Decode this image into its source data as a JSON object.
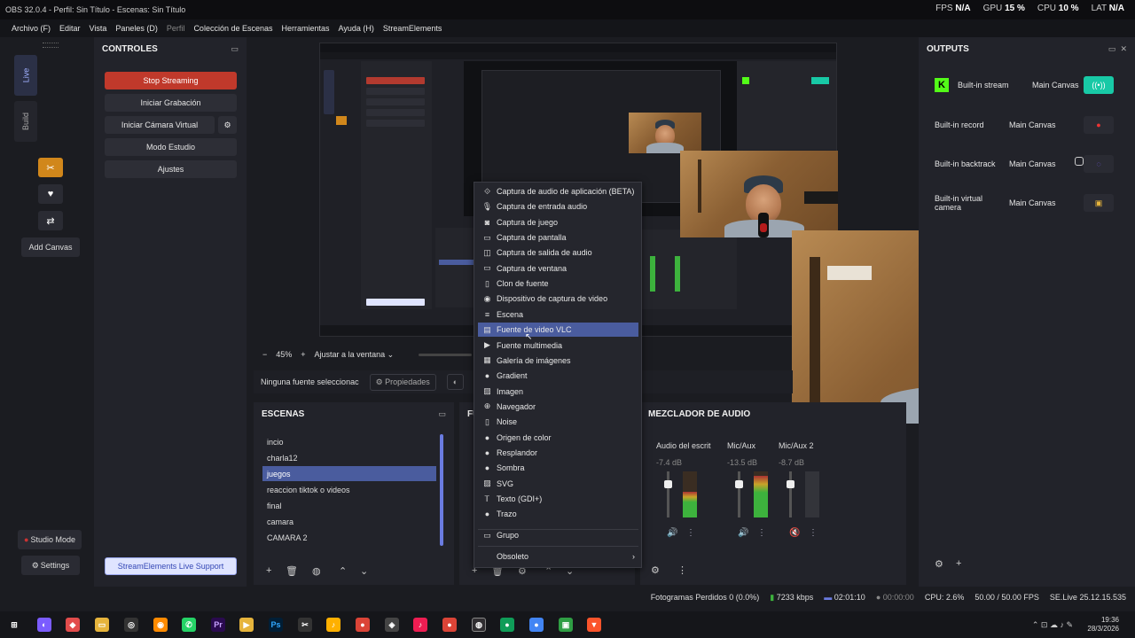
{
  "window": {
    "title": "OBS 32.0.4 - Perfil: Sin Título - Escenas: Sin Título",
    "stats": {
      "fps_label": "FPS",
      "fps_value": "N/A",
      "gpu_label": "GPU",
      "gpu_value": "15 %",
      "cpu_label": "CPU",
      "cpu_value": "10 %",
      "lat_label": "LAT",
      "lat_value": "N/A"
    }
  },
  "menubar": {
    "archivo": "Archivo (F)",
    "editar": "Editar",
    "vista": "Vista",
    "paneles": "Paneles (D)",
    "perfil": "Perfil",
    "coleccion": "Colección de Escenas",
    "herramientas": "Herramientas",
    "ayuda": "Ayuda (H)",
    "streamelements": "StreamElements"
  },
  "rail": {
    "tab_live": "Live",
    "tab_build": "Build",
    "add_canvas": "Add Canvas",
    "studio_mode": "Studio Mode",
    "settings": "Settings",
    "icons": [
      "scissors-icon",
      "heart-icon",
      "share-icon"
    ]
  },
  "controls": {
    "title": "CONTROLES",
    "stop_streaming": "Stop Streaming",
    "start_recording": "Iniciar Grabación",
    "start_virtualcam": "Iniciar Cámara Virtual",
    "studio_mode": "Modo Estudio",
    "settings": "Ajustes",
    "se_support": "StreamElements Live Support"
  },
  "preview": {
    "zoom": "45%",
    "fit": "Ajustar a la ventana",
    "no_source": "Ninguna fuente seleccionac",
    "properties": "Propiedades"
  },
  "scenes": {
    "title": "ESCENAS",
    "items": [
      "incio",
      "charla12",
      "juegos",
      "reaccion tiktok o videos",
      "final",
      "camara",
      "CAMARA 2"
    ],
    "selected_index": 2
  },
  "sources": {
    "title_partial": "FU"
  },
  "mixer": {
    "title": "MEZCLADOR DE AUDIO",
    "channels": [
      {
        "name": "Audio del escrit",
        "db": "-7.4 dB",
        "level": 0.55,
        "muted": false
      },
      {
        "name": "Mic/Aux",
        "db": "-13.5 dB",
        "level": 0.9,
        "muted": false
      },
      {
        "name": "Mic/Aux 2",
        "db": "-8.7 dB",
        "level": 0.0,
        "muted": true
      }
    ]
  },
  "outputs": {
    "title": "OUTPUTS",
    "rows": [
      {
        "name": "Built-in stream",
        "canvas": "Main Canvas",
        "active": true
      },
      {
        "name": "Built-in record",
        "canvas": "Main Canvas",
        "active": false
      },
      {
        "name": "Built-in backtrack",
        "canvas": "Main Canvas",
        "active": false
      },
      {
        "name": "Built-in virtual camera",
        "canvas": "Main Canvas",
        "active": false
      }
    ]
  },
  "context_menu": {
    "items": [
      {
        "label": "Captura de audio de aplicación (BETA)",
        "icon": "app-audio-icon"
      },
      {
        "label": "Captura de entrada audio",
        "icon": "microphone-icon"
      },
      {
        "label": "Captura de juego",
        "icon": "gamepad-icon"
      },
      {
        "label": "Captura de pantalla",
        "icon": "monitor-icon"
      },
      {
        "label": "Captura de salida de audio",
        "icon": "speaker-icon"
      },
      {
        "label": "Captura de ventana",
        "icon": "window-icon"
      },
      {
        "label": "Clon de fuente",
        "icon": "clone-icon"
      },
      {
        "label": "Dispositivo de captura de video",
        "icon": "camera-icon"
      },
      {
        "label": "Escena",
        "icon": "scene-icon"
      },
      {
        "label": "Fuente de video VLC",
        "icon": "film-icon"
      },
      {
        "label": "Fuente multimedia",
        "icon": "media-icon"
      },
      {
        "label": "Galería de imágenes",
        "icon": "gallery-icon"
      },
      {
        "label": "Gradient",
        "icon": "drop-icon"
      },
      {
        "label": "Imagen",
        "icon": "image-icon"
      },
      {
        "label": "Navegador",
        "icon": "globe-icon"
      },
      {
        "label": "Noise",
        "icon": "file-icon"
      },
      {
        "label": "Origen de color",
        "icon": "drop-icon"
      },
      {
        "label": "Resplandor",
        "icon": "drop-icon"
      },
      {
        "label": "Sombra",
        "icon": "drop-icon"
      },
      {
        "label": "SVG",
        "icon": "image-icon"
      },
      {
        "label": "Texto (GDI+)",
        "icon": "text-icon"
      },
      {
        "label": "Trazo",
        "icon": "drop-icon"
      }
    ],
    "selected_index": 9,
    "group": "Grupo",
    "obsolete": "Obsoleto"
  },
  "statusbar": {
    "dropped": "Fotogramas Perdidos 0 (0.0%)",
    "bitrate": "7233 kbps",
    "stream_time": "02:01:10",
    "rec_time": "00:00:00",
    "cpu": "CPU: 2.6%",
    "fps": "50.00 / 50.00 FPS",
    "se": "SE.Live 25.12.15.535"
  },
  "taskbar": {
    "time": "19:36",
    "date": "28/3/2026"
  }
}
